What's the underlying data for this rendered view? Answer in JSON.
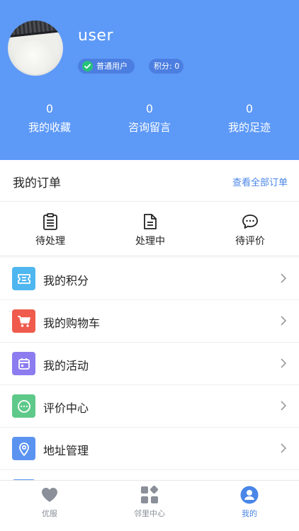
{
  "profile": {
    "username": "user",
    "role_badge": "普通用户",
    "points_badge": "积分: 0"
  },
  "stats": [
    {
      "value": "0",
      "label": "我的收藏"
    },
    {
      "value": "0",
      "label": "咨询留言"
    },
    {
      "value": "0",
      "label": "我的足迹"
    }
  ],
  "orders": {
    "title": "我的订单",
    "view_all": "查看全部订单",
    "items": [
      {
        "label": "待处理",
        "icon": "clipboard-list-icon"
      },
      {
        "label": "处理中",
        "icon": "document-icon"
      },
      {
        "label": "待评价",
        "icon": "chat-bubble-icon"
      }
    ]
  },
  "menu": [
    {
      "label": "我的积分",
      "icon": "ticket-icon",
      "color": "#4fb6f0"
    },
    {
      "label": "我的购物车",
      "icon": "cart-icon",
      "color": "#ef5b4c"
    },
    {
      "label": "我的活动",
      "icon": "calendar-icon",
      "color": "#8c7cf0"
    },
    {
      "label": "评价中心",
      "icon": "chat-icon",
      "color": "#5fc98a"
    },
    {
      "label": "地址管理",
      "icon": "location-pin-icon",
      "color": "#5b93f1"
    }
  ],
  "tabs": [
    {
      "label": "优服",
      "icon": "heart-icon",
      "active": false
    },
    {
      "label": "邻里中心",
      "icon": "grid-apps-icon",
      "active": false
    },
    {
      "label": "我的",
      "icon": "user-icon",
      "active": true
    }
  ],
  "colors": {
    "header_bg": "#5d99f7",
    "accent": "#4a86e8",
    "badge_bg": "#4b7ee0",
    "check_green": "#27c27a"
  }
}
